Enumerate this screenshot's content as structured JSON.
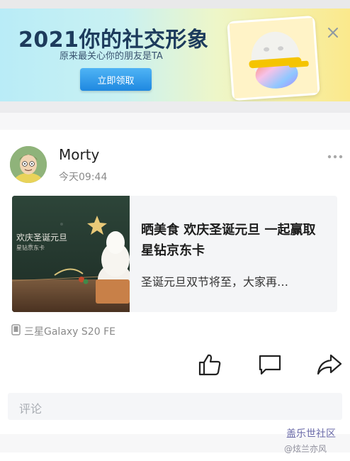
{
  "banner": {
    "title": "2021你的社交形象",
    "subtitle": "原来最关心你的朋友是TA",
    "button_label": "立即领取"
  },
  "post": {
    "username": "Morty",
    "time": "今天09:44",
    "card": {
      "image_text_main": "欢庆圣诞元旦",
      "image_text_sub": "星钻京东卡",
      "title": "晒美食 欢庆圣诞元旦 一起赢取星钻京东卡",
      "description": "圣诞元旦双节将至，大家再…"
    },
    "device": "三星Galaxy S20 FE"
  },
  "comment": {
    "placeholder": "评论"
  },
  "watermark": {
    "brand": "盖乐世社区",
    "user": "@炫兰亦风"
  },
  "icons": {
    "close": "close-icon",
    "more": "more-icon",
    "device": "phone-icon",
    "like": "thumbs-up-icon",
    "comment": "comment-icon",
    "share": "share-icon"
  }
}
